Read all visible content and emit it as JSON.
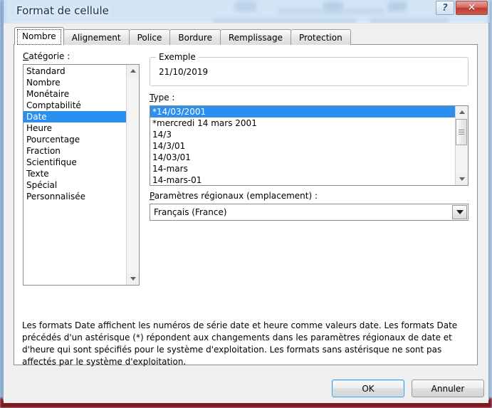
{
  "window": {
    "title": "Format de cellule",
    "help_button_label": "?",
    "close_button_label": "✕"
  },
  "tabs": [
    {
      "label": "Nombre",
      "active": true
    },
    {
      "label": "Alignement",
      "active": false
    },
    {
      "label": "Police",
      "active": false
    },
    {
      "label": "Bordure",
      "active": false
    },
    {
      "label": "Remplissage",
      "active": false
    },
    {
      "label": "Protection",
      "active": false
    }
  ],
  "category": {
    "label": "Catégorie :",
    "label_accel": "C",
    "items": [
      "Standard",
      "Nombre",
      "Monétaire",
      "Comptabilité",
      "Date",
      "Heure",
      "Pourcentage",
      "Fraction",
      "Scientifique",
      "Texte",
      "Spécial",
      "Personnalisée"
    ],
    "selected": "Date",
    "selected_index": 4
  },
  "exemple": {
    "legend": "Exemple",
    "value": "21/10/2019"
  },
  "type": {
    "label": "Type :",
    "label_accel": "T",
    "items": [
      "*14/03/2001",
      "*mercredi 14 mars 2001",
      "14/3",
      "14/3/01",
      "14/03/01",
      "14-mars",
      "14-mars-01"
    ],
    "selected": "*14/03/2001",
    "selected_index": 0
  },
  "locale": {
    "label": "Paramètres régionaux (emplacement) :",
    "label_accel": "P",
    "value": "Français (France)",
    "dropdown_icon": "chevron-down-icon"
  },
  "description": "Les formats Date affichent les numéros de série date et heure comme valeurs date. Les formats Date précédés d'un astérisque (*) répondent aux changements dans les paramètres régionaux de date et d'heure qui sont spécifiés pour le système d'exploitation. Les formats sans astérisque ne sont pas affectés par le système d'exploitation.",
  "footer": {
    "ok_label": "OK",
    "cancel_label": "Annuler"
  },
  "colors": {
    "selection_blue": "#2a8fef",
    "close_red": "#bf3b32",
    "default_button_outline": "#2f9fe0",
    "dialog_face": "#f0f0f0",
    "panel_white": "#ffffff"
  }
}
